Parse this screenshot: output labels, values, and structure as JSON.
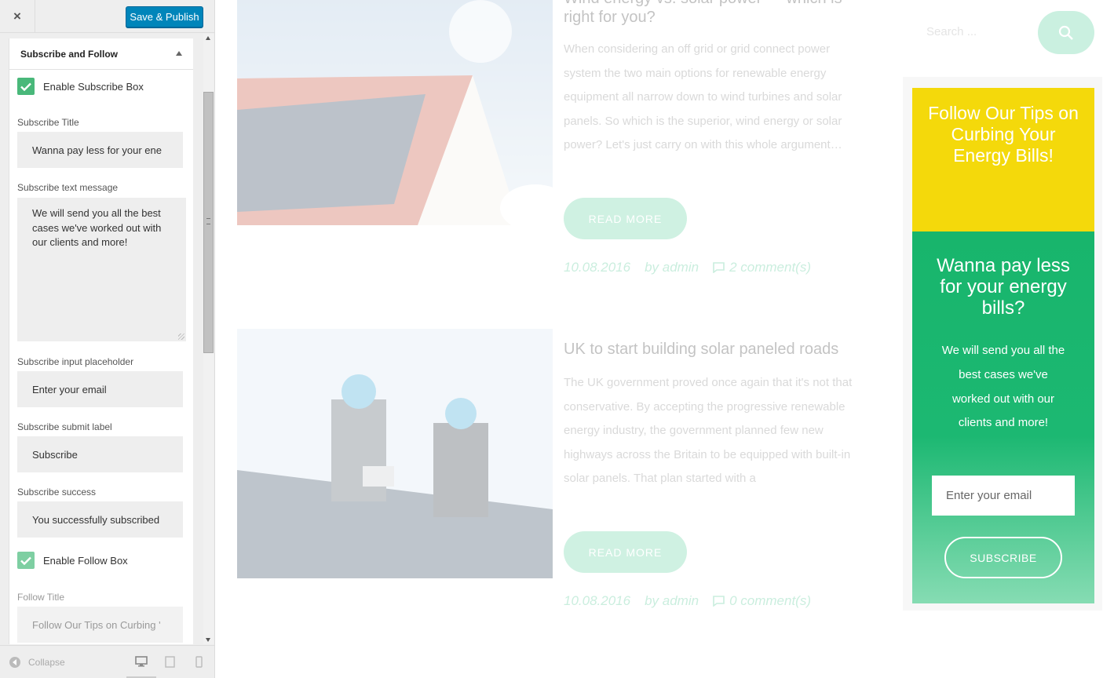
{
  "customizer": {
    "close_label": "×",
    "save_label": "Save & Publish",
    "section_title": "Subscribe and Follow",
    "enable_subscribe_label": "Enable Subscribe Box",
    "subscribe_title": {
      "label": "Subscribe Title",
      "value": "Wanna pay less for your ene"
    },
    "subscribe_text": {
      "label": "Subscribe text message",
      "value": "We will send you all the best cases we've worked out with our clients and more!"
    },
    "subscribe_placeholder": {
      "label": "Subscribe input placeholder",
      "value": "Enter your email"
    },
    "subscribe_submit": {
      "label": "Subscribe submit label",
      "value": "Subscribe"
    },
    "subscribe_success": {
      "label": "Subscribe success",
      "value": "You successfully subscribed"
    },
    "enable_follow_label": "Enable Follow Box",
    "follow_title": {
      "label": "Follow Title",
      "value": "Follow Our Tips on Curbing '"
    },
    "collapse_label": "Collapse"
  },
  "preview": {
    "post1": {
      "title": "Wind energy vs. solar power — which is right for you?",
      "excerpt": "When considering an off grid or grid connect power system the two main options for renewable energy equipment all narrow down to wind turbines and solar panels. So which is the superior, wind energy or solar power? Let's just carry on with this whole argument…",
      "read_more": "READ MORE",
      "date": "10.08.2016",
      "author": "by admin",
      "comments": "2 comment(s)"
    },
    "post2": {
      "title": "UK to start building solar paneled roads",
      "excerpt": "The UK government proved once again that it's not that conservative. By accepting the progressive renewable energy industry, the government planned few new highways across the Britain to be equipped with built-in solar panels. That plan started with a",
      "read_more": "READ MORE",
      "date": "10.08.2016",
      "author": "by admin",
      "comments": "0 comment(s)"
    },
    "search_placeholder": "Search ...",
    "follow_box_title": "Follow Our Tips on Curbing Your Energy Bills!",
    "subscribe_box": {
      "title": "Wanna pay less for your energy bills?",
      "message": "We will send you all the best cases we've worked out with our clients and more!",
      "input_placeholder": "Enter your email",
      "button_label": "SUBSCRIBE"
    }
  },
  "colors": {
    "primary_button": "#0085ba",
    "checkbox": "#49b87a",
    "follow_yellow": "#f4d90b",
    "subscribe_green": "#18b56c",
    "accent_mint": "#58cf9e"
  },
  "icons": {
    "close": "close-icon",
    "section_collapse": "caret-up-icon",
    "checkbox": "checkmark-icon",
    "collapse": "collapse-arrow-icon",
    "devices": [
      "desktop-icon",
      "tablet-icon",
      "mobile-icon"
    ],
    "search": "search-icon",
    "comment": "comment-icon"
  }
}
